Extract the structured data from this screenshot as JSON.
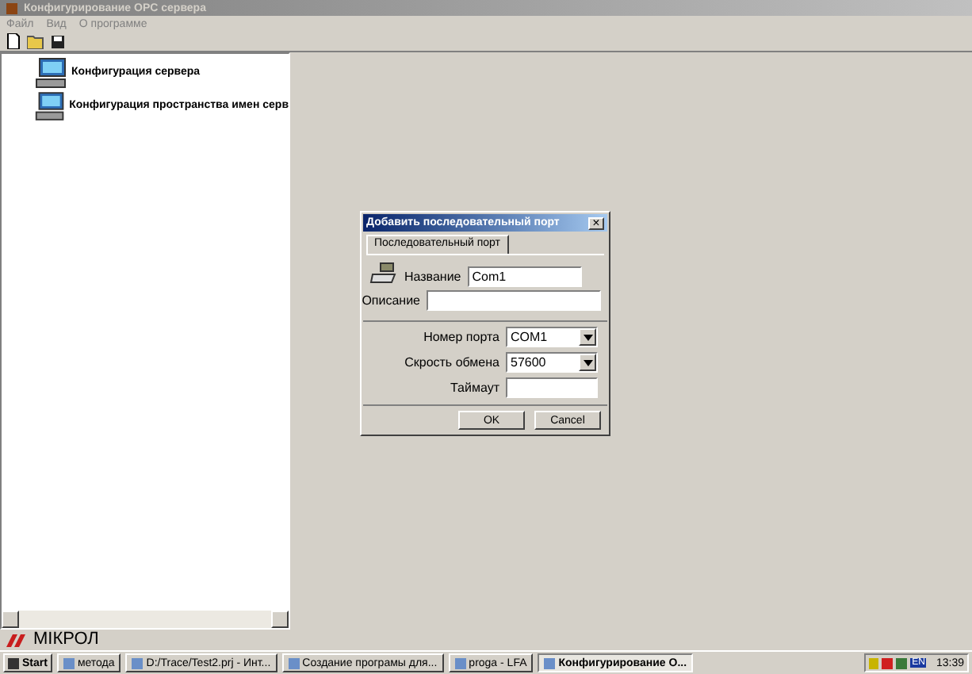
{
  "window": {
    "title": "Конфигурирование OPC сервера"
  },
  "menu": [
    "Файл",
    "Вид",
    "О программе"
  ],
  "tree": {
    "items": [
      {
        "label": "Конфигурация сервера"
      },
      {
        "label": "Конфигурация пространства имен серв"
      }
    ]
  },
  "dialog": {
    "title": "Добавить последовательный порт",
    "close": "×",
    "tabs": [
      {
        "label": "Последовательный порт",
        "selected": true
      }
    ],
    "name": {
      "label": "Название",
      "value": "Com1"
    },
    "description": {
      "label": "Описание"
    },
    "port": {
      "label": "Номер порта",
      "value": "COM1"
    },
    "speed": {
      "label": "Скрость обмена",
      "value": "57600"
    },
    "timeout": {
      "label": "Таймаут"
    },
    "buttons": [
      "OK",
      "Cancel"
    ]
  },
  "logo": "МIКРОЛ",
  "taskbar": {
    "start": "Start",
    "tasks": [
      {
        "label": "метода",
        "selected": false
      },
      {
        "label": "D:/Trace/Test2.prj - Инт...",
        "selected": false
      },
      {
        "label": "Создание програмы для...",
        "selected": false
      },
      {
        "label": "proga - LFA",
        "selected": false
      },
      {
        "label": "Конфигурирование O...",
        "selected": true
      }
    ],
    "lang": "EN",
    "clock": "13:39"
  }
}
